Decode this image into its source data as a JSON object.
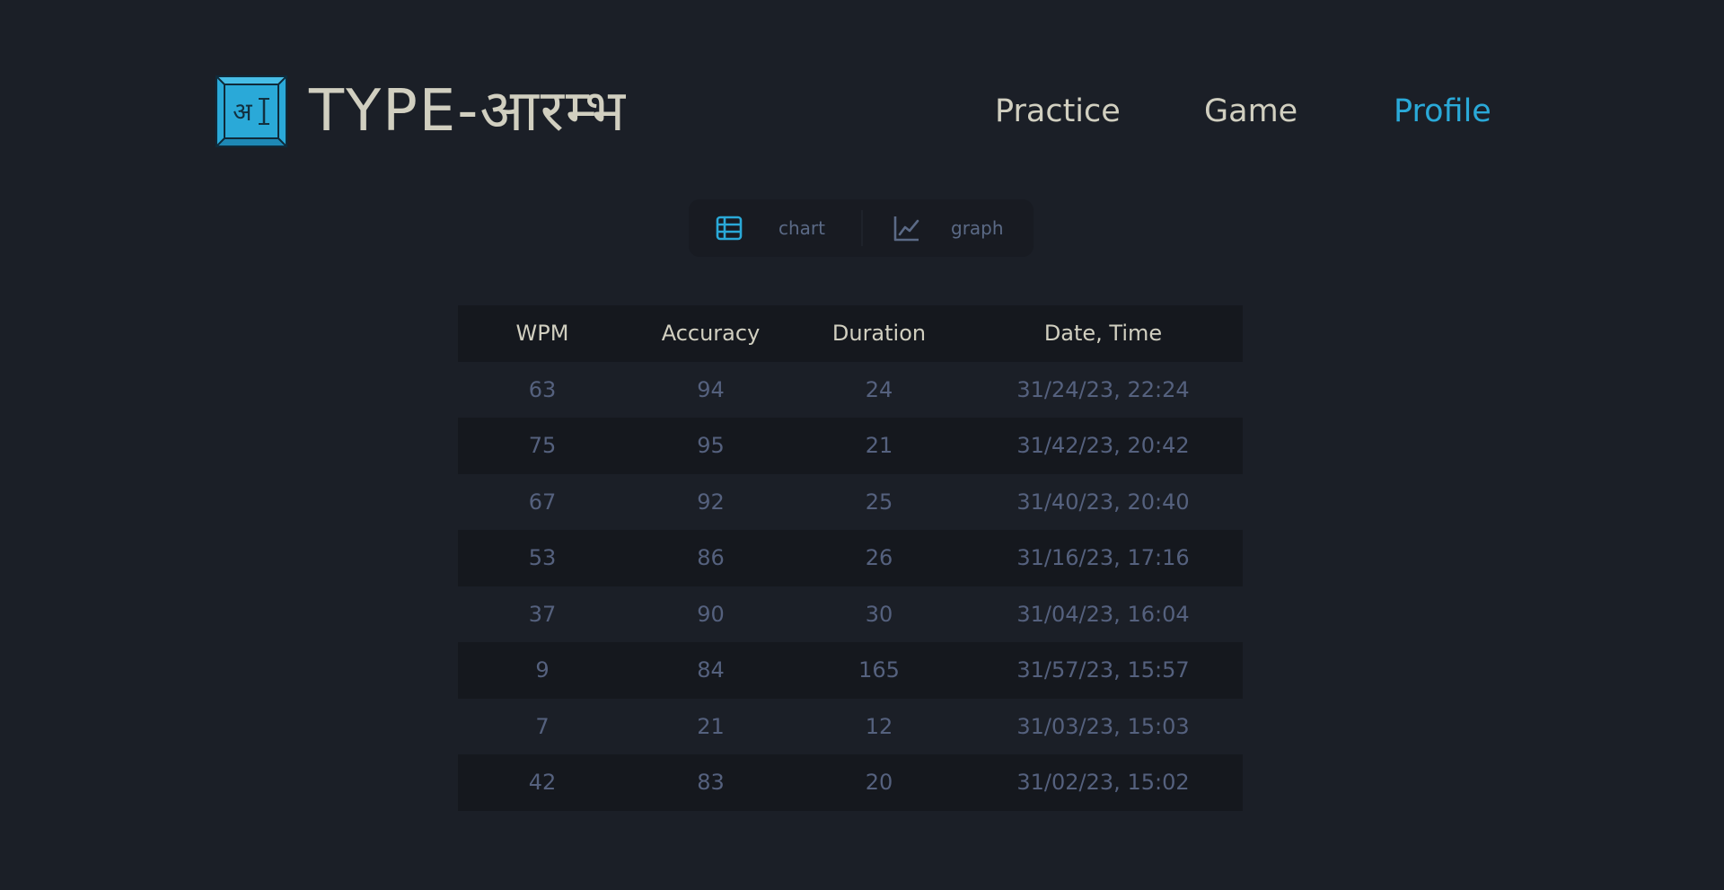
{
  "brand": {
    "logo_glyph": "अ",
    "title": "TYPE-आरम्भ",
    "accent_color": "#2aa9d8"
  },
  "nav": {
    "items": [
      {
        "label": "Practice",
        "active": false
      },
      {
        "label": "Game",
        "active": false
      },
      {
        "label": "Profile",
        "active": true
      }
    ]
  },
  "view_toggle": {
    "chart": {
      "label": "chart",
      "icon": "table-icon",
      "active": true
    },
    "graph": {
      "label": "graph",
      "icon": "line-chart-icon",
      "active": false
    }
  },
  "history_table": {
    "columns": [
      "WPM",
      "Accuracy",
      "Duration",
      "Date, Time"
    ],
    "rows": [
      [
        "63",
        "94",
        "24",
        "31/24/23, 22:24"
      ],
      [
        "75",
        "95",
        "21",
        "31/42/23, 20:42"
      ],
      [
        "67",
        "92",
        "25",
        "31/40/23, 20:40"
      ],
      [
        "53",
        "86",
        "26",
        "31/16/23, 17:16"
      ],
      [
        "37",
        "90",
        "30",
        "31/04/23, 16:04"
      ],
      [
        "9",
        "84",
        "165",
        "31/57/23, 15:57"
      ],
      [
        "7",
        "21",
        "12",
        "31/03/23, 15:03"
      ],
      [
        "42",
        "83",
        "20",
        "31/02/23, 15:02"
      ]
    ]
  }
}
